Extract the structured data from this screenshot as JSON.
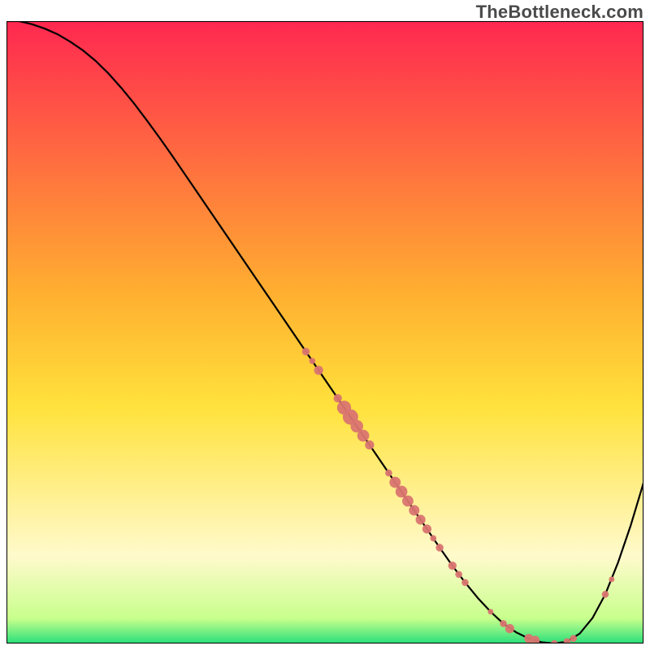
{
  "watermark": "TheBottleneck.com",
  "colors": {
    "gradient_top": "#ff2850",
    "gradient_mid": "#ffe23c",
    "gradient_low": "#ffff96",
    "gradient_bottom": "#28e07a",
    "curve": "#000000",
    "marker_fill": "#da7570",
    "frame": "#000000",
    "page_bg": "#ffffff"
  },
  "chart_data": {
    "type": "line",
    "title": "",
    "xlabel": "",
    "ylabel": "",
    "xlim": [
      0,
      100
    ],
    "ylim": [
      0,
      100
    ],
    "legend": false,
    "grid": false,
    "x": [
      0,
      2,
      4,
      6,
      8,
      10,
      12,
      14,
      16,
      18,
      20,
      22,
      24,
      26,
      28,
      30,
      32,
      34,
      36,
      38,
      40,
      42,
      44,
      46,
      48,
      50,
      52,
      54,
      56,
      58,
      60,
      62,
      64,
      66,
      68,
      70,
      72,
      74,
      76,
      78,
      80,
      82,
      84,
      86,
      88,
      90,
      92,
      94,
      96,
      98,
      100
    ],
    "y": [
      100,
      100,
      99.5,
      98.8,
      97.9,
      96.7,
      95.3,
      93.6,
      91.6,
      89.3,
      86.8,
      84.1,
      81.3,
      78.4,
      75.4,
      72.4,
      69.4,
      66.4,
      63.4,
      60.4,
      57.4,
      54.4,
      51.4,
      48.4,
      45.4,
      42.4,
      39.4,
      36.4,
      33.4,
      30.4,
      27.4,
      24.4,
      21.4,
      18.4,
      15.4,
      12.5,
      9.8,
      7.3,
      5.1,
      3.2,
      1.8,
      0.8,
      0.2,
      0,
      0.3,
      1.6,
      4.1,
      7.9,
      13.0,
      19.0,
      25.8
    ],
    "markers": [
      {
        "x": 47,
        "y": 46.9,
        "r": 1.1
      },
      {
        "x": 48,
        "y": 45.4,
        "r": 0.9
      },
      {
        "x": 49,
        "y": 43.9,
        "r": 1.3
      },
      {
        "x": 52,
        "y": 39.4,
        "r": 1.2
      },
      {
        "x": 53,
        "y": 37.9,
        "r": 2.0
      },
      {
        "x": 54,
        "y": 36.4,
        "r": 2.2
      },
      {
        "x": 55,
        "y": 34.9,
        "r": 1.8
      },
      {
        "x": 56,
        "y": 33.4,
        "r": 1.7
      },
      {
        "x": 57,
        "y": 31.9,
        "r": 1.3
      },
      {
        "x": 60,
        "y": 27.4,
        "r": 1.0
      },
      {
        "x": 61,
        "y": 25.9,
        "r": 1.6
      },
      {
        "x": 62,
        "y": 24.4,
        "r": 1.7
      },
      {
        "x": 63,
        "y": 22.9,
        "r": 1.6
      },
      {
        "x": 64,
        "y": 21.4,
        "r": 1.5
      },
      {
        "x": 65,
        "y": 19.9,
        "r": 1.4
      },
      {
        "x": 66,
        "y": 18.4,
        "r": 1.3
      },
      {
        "x": 67,
        "y": 16.9,
        "r": 0.9
      },
      {
        "x": 68,
        "y": 15.4,
        "r": 1.1
      },
      {
        "x": 70,
        "y": 12.5,
        "r": 1.2
      },
      {
        "x": 71,
        "y": 11.1,
        "r": 1.0
      },
      {
        "x": 72,
        "y": 9.8,
        "r": 1.0
      },
      {
        "x": 76,
        "y": 5.1,
        "r": 0.8
      },
      {
        "x": 78,
        "y": 3.2,
        "r": 1.0
      },
      {
        "x": 79,
        "y": 2.4,
        "r": 1.3
      },
      {
        "x": 82,
        "y": 0.8,
        "r": 1.3
      },
      {
        "x": 83,
        "y": 0.5,
        "r": 1.3
      },
      {
        "x": 86,
        "y": 0,
        "r": 1.0
      },
      {
        "x": 88,
        "y": 0.3,
        "r": 1.0
      },
      {
        "x": 89,
        "y": 0.8,
        "r": 1.0
      },
      {
        "x": 94,
        "y": 7.9,
        "r": 1.0
      },
      {
        "x": 95,
        "y": 10.3,
        "r": 0.8
      }
    ]
  }
}
